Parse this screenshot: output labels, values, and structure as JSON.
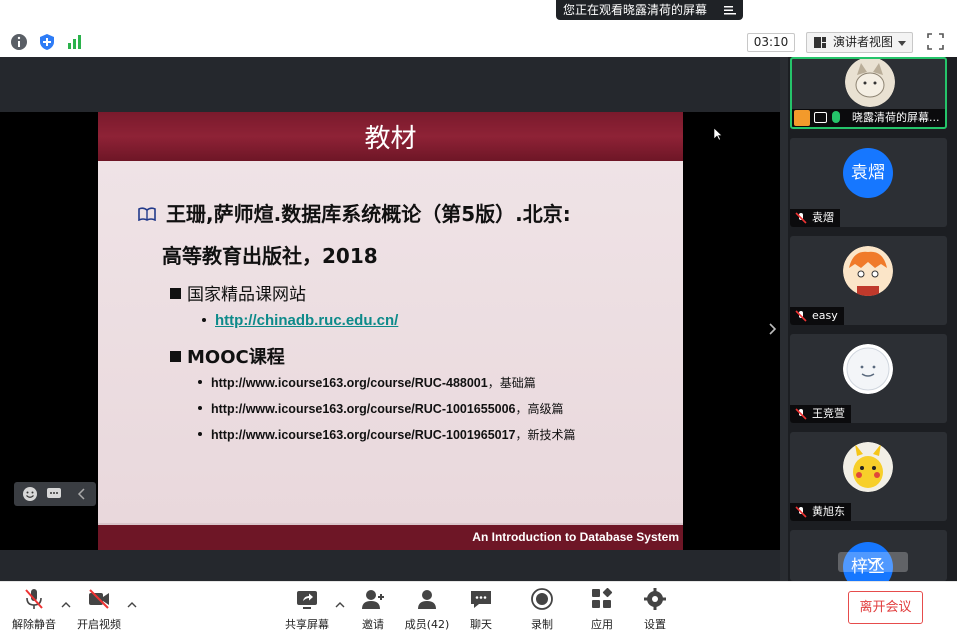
{
  "topbar": {
    "share_banner": "您正在观看晓露清荷的屏幕",
    "timer": "03:10",
    "view_mode": "演讲者视图"
  },
  "slide": {
    "title": "教材",
    "ref_line1": "王珊,萨师煊.数据库系统概论（第5版）.北京:",
    "ref_line2": "高等教育出版社，2018",
    "sub1": "国家精品课网站",
    "link1": "http://chinadb.ruc.edu.cn/",
    "sub2": "MOOC课程",
    "mooc": [
      {
        "url": "http://www.icourse163.org/course/RUC-488001",
        "note": "，基础篇"
      },
      {
        "url": "http://www.icourse163.org/course/RUC-1001655006",
        "note": "，高级篇"
      },
      {
        "url": "http://www.icourse163.org/course/RUC-1001965017",
        "note": "，新技术篇"
      }
    ],
    "footer": "An Introduction to Database System"
  },
  "participants": [
    {
      "name": "晓露清荷的屏幕...",
      "avatar": "cat-avatar"
    },
    {
      "name": "袁熠",
      "avatar_text": "袁熠"
    },
    {
      "name": "easy",
      "avatar": "cartoon-avatar"
    },
    {
      "name": "王竞萱",
      "avatar": "smile-avatar"
    },
    {
      "name": "黄旭东",
      "avatar": "pikachu-avatar"
    },
    {
      "name": "",
      "avatar_text": "梓丞"
    }
  ],
  "bottombar": {
    "unmute": "解除静音",
    "video": "开启视频",
    "share": "共享屏幕",
    "invite": "邀请",
    "members": "成员(42)",
    "chat": "聊天",
    "record": "录制",
    "apps": "应用",
    "settings": "设置",
    "leave": "离开会议"
  },
  "colors": {
    "accent_green": "#25c46a",
    "slide_maroon": "#7a1a2c",
    "leave_red": "#e13c3c",
    "avatar_blue": "#1677ff"
  }
}
